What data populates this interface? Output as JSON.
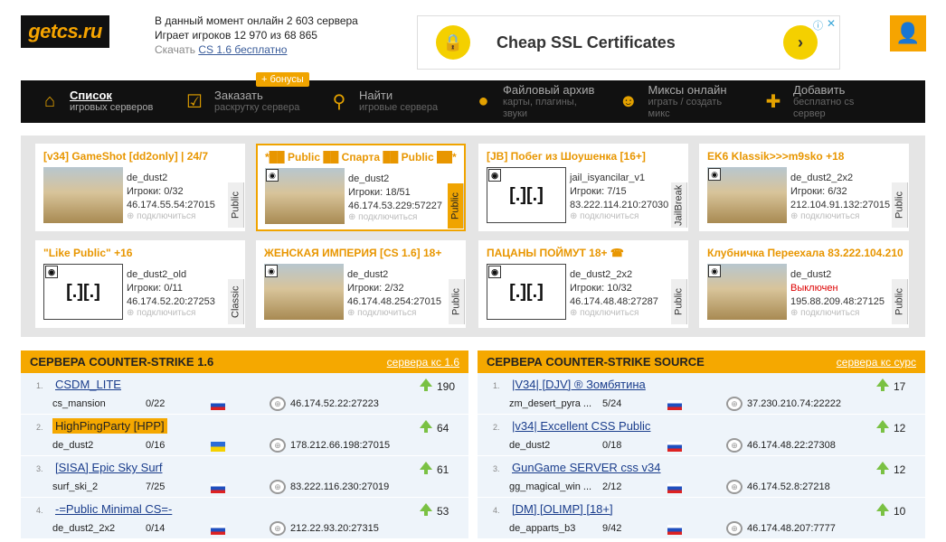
{
  "logo": "getcs.ru",
  "stats": {
    "line1": "В данный момент онлайн 2 603 сервера",
    "line2": "Играет игроков 12 970 из 68 865",
    "dl_prefix": "Скачать",
    "dl_link": "CS 1.6 бесплатно"
  },
  "ad": {
    "title": "Cheap SSL Certificates",
    "go": "›",
    "info": "ⓘ",
    "close": "✕"
  },
  "bonus": "+ бонусы",
  "nav": [
    {
      "t1": "Список",
      "t2": "игровых серверов",
      "icon": "home-icon",
      "glyph": "⌂"
    },
    {
      "t1": "Заказать",
      "t2": "раскрутку сервера",
      "icon": "check-icon",
      "glyph": "☑"
    },
    {
      "t1": "Найти",
      "t2": "игровые сервера",
      "icon": "search-icon",
      "glyph": "⚲"
    },
    {
      "t1": "Файловый архив",
      "t2": "карты, плагины, звуки",
      "icon": "planet-icon",
      "glyph": "●"
    },
    {
      "t1": "Миксы онлайн",
      "t2": "играть / создать микс",
      "icon": "counter-strike-icon",
      "glyph": "☻"
    },
    {
      "t1": "Добавить",
      "t2": "бесплатно cs сервер",
      "icon": "plus-icon",
      "glyph": "✚"
    }
  ],
  "featured": [
    {
      "name": "[v34] GameShot [dd2only] | 24/7",
      "map": "de_dust2",
      "players": "Игроки: 0/32",
      "ip": "46.174.55.54:27015",
      "status": "подключиться",
      "tag": "Public",
      "blank": false,
      "game": ""
    },
    {
      "name": "*██ Public ██ Спарта ██ Public ██*",
      "map": "de_dust2",
      "players": "Игроки: 18/51",
      "ip": "46.174.53.229:57227",
      "status": "подключиться",
      "tag": "Public",
      "blank": false,
      "game": "cs"
    },
    {
      "name": "[JB] Побег из Шоушенка [16+]",
      "map": "jail_isyancilar_v1",
      "players": "Игроки: 7/15",
      "ip": "83.222.114.210:27030",
      "status": "подключиться",
      "tag": "JailBreak",
      "blank": true,
      "game": "cs"
    },
    {
      "name": "EK6 Klassik>>>m9sko +18",
      "map": "de_dust2_2x2",
      "players": "Игроки: 6/32",
      "ip": "212.104.91.132:27015",
      "status": "подключиться",
      "tag": "Public",
      "blank": false,
      "game": "cs"
    },
    {
      "name": "\"Like Public\" +16",
      "map": "de_dust2_old",
      "players": "Игроки: 0/11",
      "ip": "46.174.52.20:27253",
      "status": "подключиться",
      "tag": "Classic",
      "blank": true,
      "game": "cs"
    },
    {
      "name": "ЖЕНСКАЯ ИМПЕРИЯ [CS 1.6] 18+",
      "map": "de_dust2",
      "players": "Игроки: 2/32",
      "ip": "46.174.48.254:27015",
      "status": "подключиться",
      "tag": "Public",
      "blank": false,
      "game": "cs"
    },
    {
      "name": "ПАЦАНЫ ПОЙМУТ 18+ ☎",
      "map": "de_dust2_2x2",
      "players": "Игроки: 10/32",
      "ip": "46.174.48.48:27287",
      "status": "подключиться",
      "tag": "Public",
      "blank": true,
      "game": "cs"
    },
    {
      "name": "Клубничка Переехала 83.222.104.210",
      "map": "de_dust2",
      "players": "Выключен",
      "ip": "195.88.209.48:27125",
      "status": "подключиться",
      "tag": "Public",
      "blank": false,
      "game": "cs",
      "off": true
    }
  ],
  "cs16": {
    "title": "СЕРВЕРА COUNTER-STRIKE 1.6",
    "link": "сервера кс 1.6",
    "rows": [
      {
        "num": "1.",
        "name": "CSDM_LITE",
        "map": "cs_mansion",
        "players": "0/22",
        "flag": "ru",
        "ip": "46.174.52.22:27223",
        "score": "190",
        "hl": false
      },
      {
        "num": "2.",
        "name": "HighPingParty [HPP]",
        "map": "de_dust2",
        "players": "0/16",
        "flag": "ua",
        "ip": "178.212.66.198:27015",
        "score": "64",
        "hl": true
      },
      {
        "num": "3.",
        "name": "[SISA] Epic Sky Surf",
        "map": "surf_ski_2",
        "players": "7/25",
        "flag": "ru",
        "ip": "83.222.116.230:27019",
        "score": "61",
        "hl": false
      },
      {
        "num": "4.",
        "name": "-=Public Minimal CS=-",
        "map": "de_dust2_2x2",
        "players": "0/14",
        "flag": "ru",
        "ip": "212.22.93.20:27315",
        "score": "53",
        "hl": false
      }
    ]
  },
  "css": {
    "title": "СЕРВЕРА COUNTER-STRIKE SOURCE",
    "link": "сервера кс сурс",
    "rows": [
      {
        "num": "1.",
        "name": "|V34| [DJV] ® Зомбятина",
        "map": "zm_desert_pyra ...",
        "players": "5/24",
        "flag": "ru",
        "ip": "37.230.210.74:22222",
        "score": "17",
        "hl": false
      },
      {
        "num": "2.",
        "name": "|v34| Excellent CSS Public",
        "map": "de_dust2",
        "players": "0/18",
        "flag": "ru",
        "ip": "46.174.48.22:27308",
        "score": "12",
        "hl": false
      },
      {
        "num": "3.",
        "name": "GunGame SERVER css v34",
        "map": "gg_magical_win ...",
        "players": "2/12",
        "flag": "ru",
        "ip": "46.174.52.8:27218",
        "score": "12",
        "hl": false
      },
      {
        "num": "4.",
        "name": "[DM] [OLIMP] [18+]",
        "map": "de_apparts_b3",
        "players": "9/42",
        "flag": "ru",
        "ip": "46.174.48.207:7777",
        "score": "10",
        "hl": false
      }
    ]
  }
}
